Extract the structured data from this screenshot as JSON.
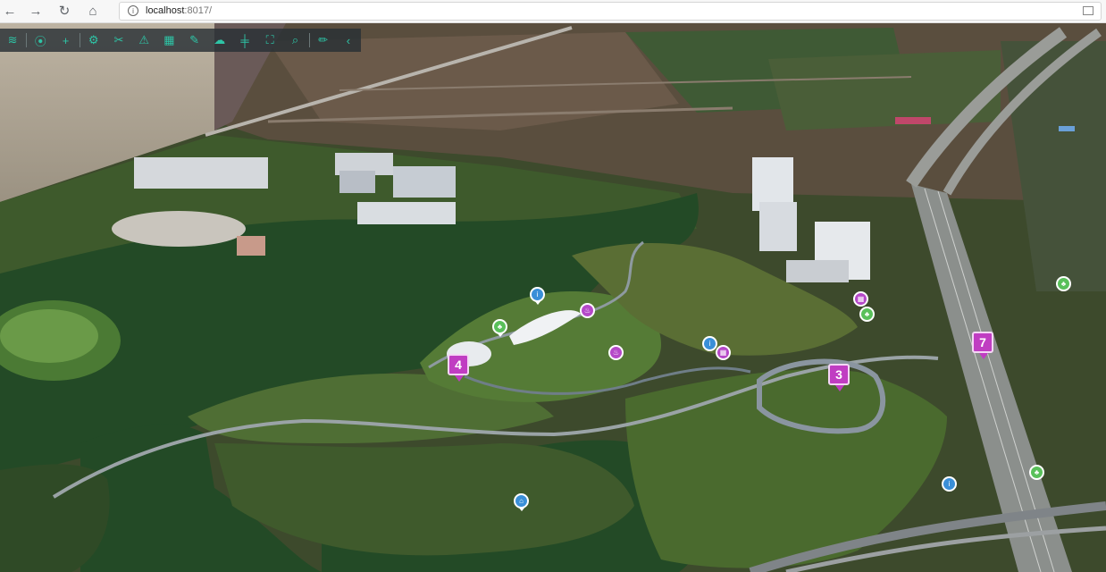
{
  "browser": {
    "back_icon": "←",
    "forward_icon": "→",
    "reload_icon": "↻",
    "home_icon": "⌂",
    "url_host": "localhost",
    "url_rest": ":8017/",
    "info_icon": "i"
  },
  "toolbar": {
    "background": "#283034",
    "accent": "#2ec4a6",
    "icons": {
      "layers": "≋",
      "location": "⦿",
      "plus": "+",
      "settings": "⚙",
      "scissors": "✂",
      "warning": "⚠",
      "building": "▦",
      "pencil": "✎",
      "cloud": "☁",
      "road": "╪",
      "frame": "⛶",
      "search": "⌕",
      "edit": "✏",
      "collapse": "‹"
    }
  },
  "markers": {
    "m4": "4",
    "m3": "3",
    "m7": "7"
  },
  "poi_icons": {
    "tree": "♣",
    "info": "i",
    "fire": "♨",
    "grid": "▦",
    "home": "⌂"
  }
}
